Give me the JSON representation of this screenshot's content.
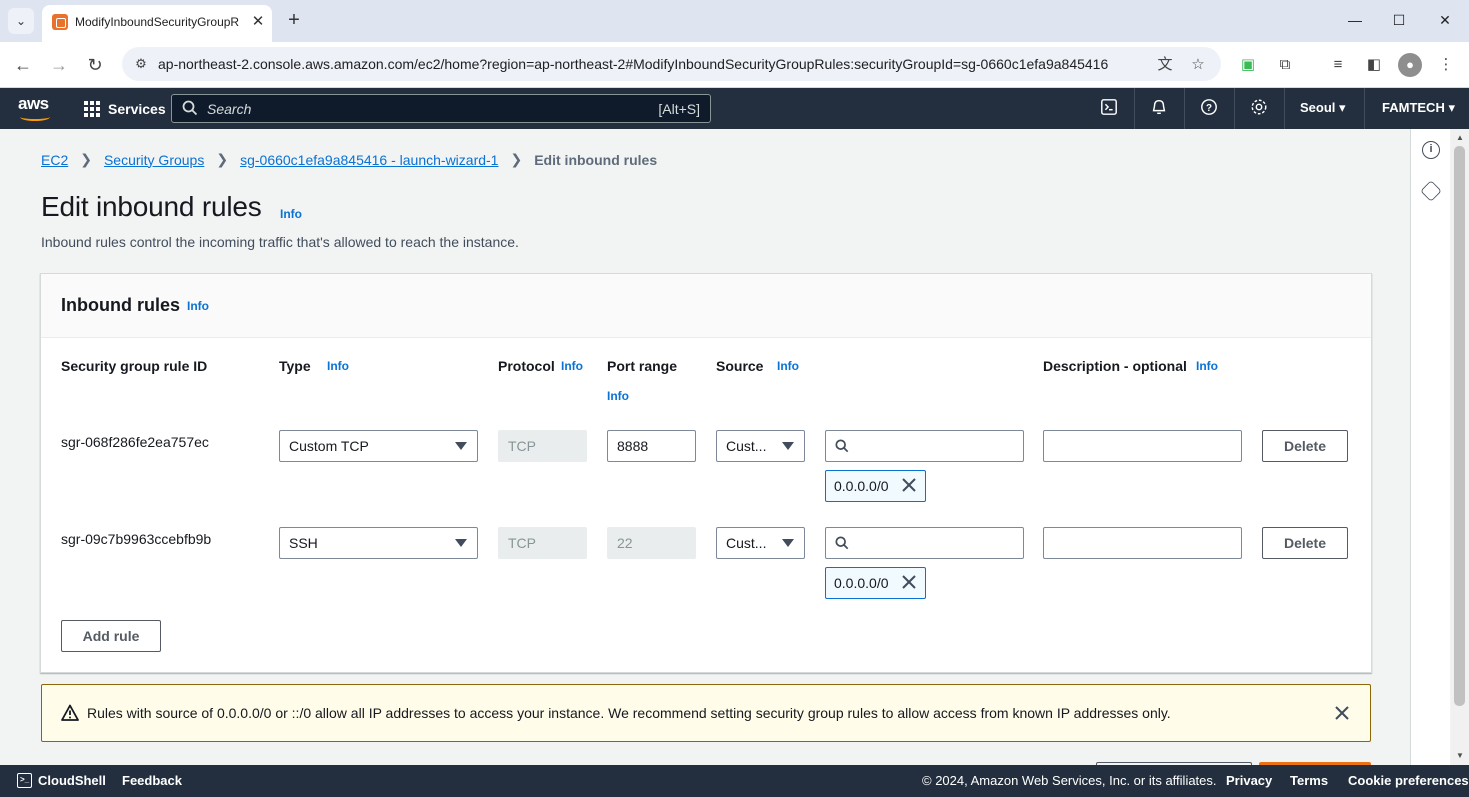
{
  "browser": {
    "tab_title": "ModifyInboundSecurityGroupR",
    "url": "ap-northeast-2.console.aws.amazon.com/ec2/home?region=ap-northeast-2#ModifyInboundSecurityGroupRules:securityGroupId=sg-0660c1efa9a845416"
  },
  "aws_header": {
    "logo": "aws",
    "services_label": "Services",
    "search_placeholder": "Search",
    "search_shortcut": "[Alt+S]",
    "region": "Seoul",
    "account": "FAMTECH"
  },
  "breadcrumb": {
    "items": [
      "EC2",
      "Security Groups",
      "sg-0660c1efa9a845416 - launch-wizard-1"
    ],
    "current": "Edit inbound rules"
  },
  "page": {
    "title": "Edit inbound rules",
    "title_info": "Info",
    "description": "Inbound rules control the incoming traffic that's allowed to reach the instance."
  },
  "panel": {
    "title": "Inbound rules",
    "title_info": "Info",
    "columns": {
      "rule_id": "Security group rule ID",
      "type": "Type",
      "protocol": "Protocol",
      "port_range": "Port range",
      "source": "Source",
      "description": "Description - optional"
    },
    "info_label": "Info",
    "rules": [
      {
        "id": "sgr-068f286fe2ea757ec",
        "type": "Custom TCP",
        "protocol": "TCP",
        "port": "8888",
        "source_type": "Cust...",
        "source_search": "",
        "source_token": "0.0.0.0/0",
        "description": "",
        "delete_label": "Delete"
      },
      {
        "id": "sgr-09c7b9963ccebfb9b",
        "type": "SSH",
        "protocol": "TCP",
        "port": "22",
        "source_type": "Cust...",
        "source_search": "",
        "source_token": "0.0.0.0/0",
        "description": "",
        "delete_label": "Delete"
      }
    ],
    "add_rule_label": "Add rule"
  },
  "warning": {
    "text": "Rules with source of 0.0.0.0/0 or ::/0 allow all IP addresses to access your instance. We recommend setting security group rules to allow access from known IP addresses only."
  },
  "footer": {
    "cloudshell": "CloudShell",
    "feedback": "Feedback",
    "copyright": "© 2024, Amazon Web Services, Inc. or its affiliates.",
    "links": [
      "Privacy",
      "Terms",
      "Cookie preferences"
    ]
  },
  "colors": {
    "aws_nav": "#232f3e",
    "link": "#0972d3",
    "warning_bg": "#fffce9",
    "warning_border": "#8d6605",
    "primary_orange": "#ec7211"
  }
}
